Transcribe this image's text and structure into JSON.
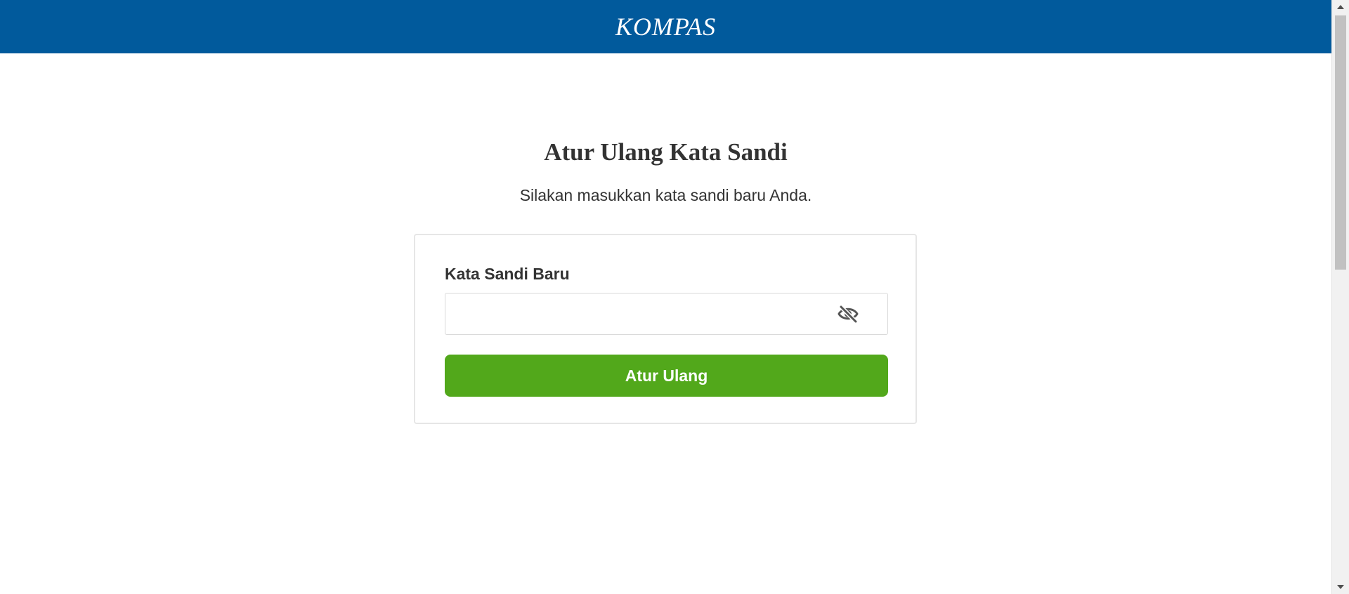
{
  "header": {
    "logo_text": "KOMPAS",
    "background_color": "#015A9C"
  },
  "main": {
    "title": "Atur Ulang Kata Sandi",
    "subtitle": "Silakan masukkan kata sandi baru Anda."
  },
  "form": {
    "password_label": "Kata Sandi Baru",
    "password_value": "",
    "password_placeholder": "",
    "visibility_icon": "eye-slash-icon",
    "submit_label": "Atur Ulang",
    "submit_color": "#52A81B"
  },
  "colors": {
    "text": "#333333",
    "card_border": "#E6E6E6",
    "icon": "#555555"
  }
}
